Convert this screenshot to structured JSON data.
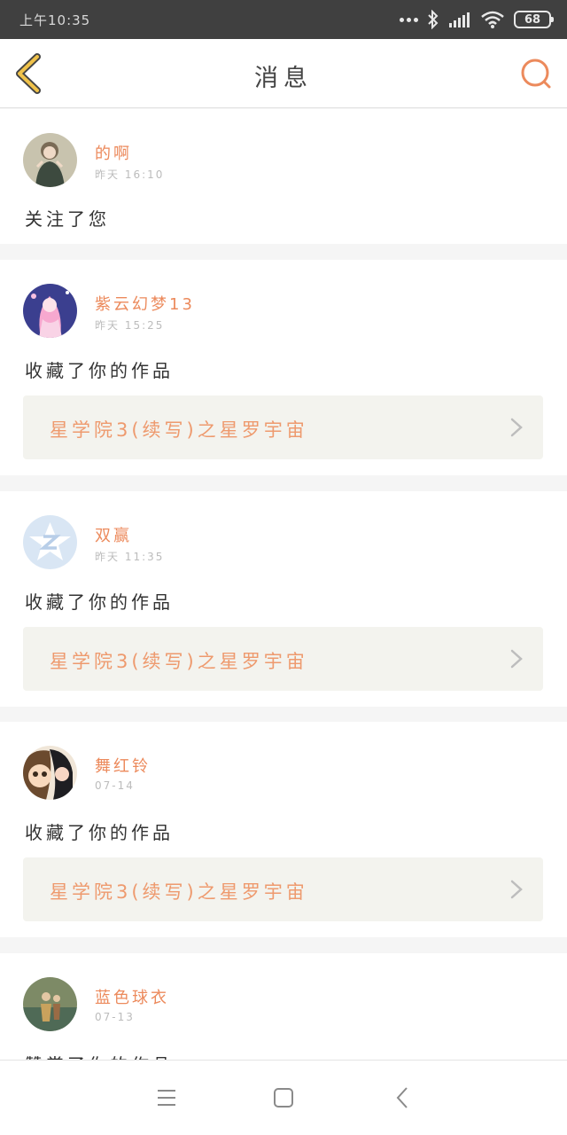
{
  "status_bar": {
    "time": "上午10:35",
    "battery": "68"
  },
  "header": {
    "title": "消息"
  },
  "messages": [
    {
      "user": "的啊",
      "time": "昨天 16:10",
      "action": "关注了您"
    },
    {
      "user": "紫云幻梦13",
      "time": "昨天 15:25",
      "action": "收藏了你的作品",
      "work": "星学院3(续写)之星罗宇宙"
    },
    {
      "user": "双赢",
      "time": "昨天 11:35",
      "action": "收藏了你的作品",
      "work": "星学院3(续写)之星罗宇宙"
    },
    {
      "user": "舞红铃",
      "time": "07-14",
      "action": "收藏了你的作品",
      "work": "星学院3(续写)之星罗宇宙"
    },
    {
      "user": "蓝色球衣",
      "time": "07-13",
      "action": "赞赏了你的作品"
    }
  ],
  "colors": {
    "accent": "#ec8a5c",
    "back_icon": "#f0c24a",
    "status_bar": "#404040"
  },
  "icons": {
    "back": "chevron-left-icon",
    "search": "search-icon",
    "menu": "menu-icon",
    "home": "home-icon",
    "system_back": "back-icon"
  }
}
